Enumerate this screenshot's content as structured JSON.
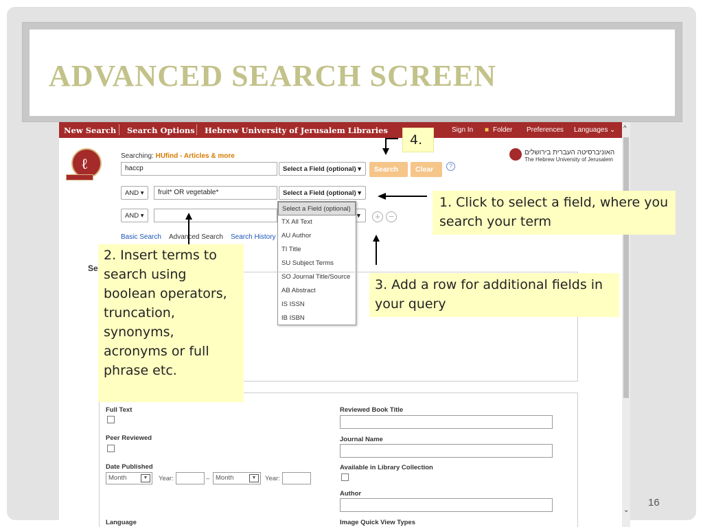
{
  "slide": {
    "title": "ADVANCED SEARCH SCREEN",
    "page_number": "16"
  },
  "topbar": {
    "new_search": "New Search",
    "search_options": "Search Options",
    "library": "Hebrew University of Jerusalem Libraries",
    "sign_in": "Sign In",
    "folder": "Folder",
    "preferences": "Preferences",
    "languages": "Languages"
  },
  "search": {
    "searching_label": "Searching:",
    "searching_db": "HUfind - Articles & more",
    "rows": [
      {
        "bool": "",
        "term": "haccp",
        "field": "Select a Field (optional)"
      },
      {
        "bool": "AND",
        "term": "fruit* OR vegetable*",
        "field": "Select a Field (optional)"
      },
      {
        "bool": "AND",
        "term": "",
        "field": ""
      }
    ],
    "search_button": "Search",
    "clear_button": "Clear",
    "help": "?",
    "links": [
      "Basic Search",
      "Advanced Search",
      "Search History"
    ]
  },
  "university": {
    "hebrew_name": "האוניברסיטה העברית בירושלים",
    "english_name": "The Hebrew University of Jerusalem"
  },
  "field_dropdown": {
    "options": [
      "Select a Field (optional)",
      "TX All Text",
      "AU Author",
      "TI Title",
      "SU Subject Terms",
      "SO Journal Title/Source",
      "AB Abstract",
      "IS ISSN",
      "IB ISBN"
    ]
  },
  "section_label": "Se",
  "limiters": {
    "full_text": "Full Text",
    "peer_reviewed": "Peer Reviewed",
    "date_published": "Date Published",
    "month": "Month",
    "year": "Year:",
    "dash": "–",
    "reviewed_book_title": "Reviewed Book Title",
    "journal_name": "Journal Name",
    "available_in_library": "Available in Library Collection",
    "author": "Author",
    "language": "Language",
    "image_quick_view": "Image Quick View Types"
  },
  "callouts": {
    "note1": "1. Click to select a field, where you search your term",
    "note2": "2. Insert terms to search using boolean operators, truncation, synonyms, acronyms or full phrase etc.",
    "note3": "3. Add a row for additional fields in your query",
    "note4": "4."
  },
  "colors": {
    "title": "#c2c28a",
    "topbar": "#a52a2a",
    "callout": "#ffffc2",
    "button": "#f5c58a"
  }
}
